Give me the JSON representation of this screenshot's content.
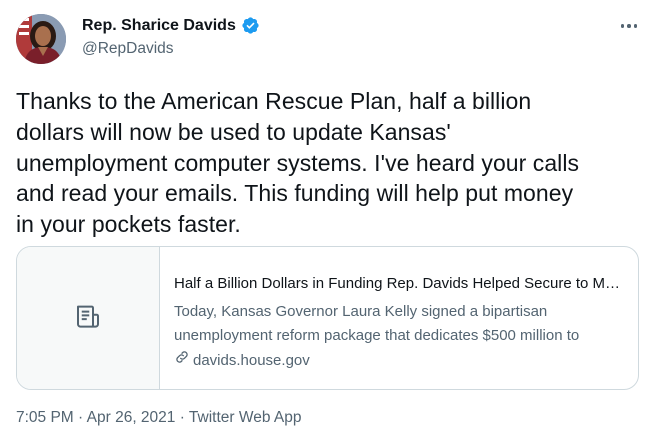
{
  "author": {
    "display_name": "Rep. Sharice Davids",
    "handle": "@RepDavids",
    "verified_icon": "verified-badge-icon"
  },
  "menu": {
    "icon": "more-icon"
  },
  "tweet": {
    "text": "Thanks to the American Rescue Plan, half a billion\ndollars will now be used to update Kansas'\nunemployment computer systems. I've heard your calls\nand read your emails. This funding will help put money\nin your pockets faster."
  },
  "card": {
    "media_icon": "document-icon",
    "title": "Half a Billion Dollars in Funding Rep. Davids Helped Secure to Modernize Kansas Unemployment System",
    "description_line1": "Today, Kansas Governor Laura Kelly signed a bipartisan",
    "description_line2": "unemployment reform package that dedicates $500 million to",
    "domain_icon": "link-icon",
    "domain": "davids.house.gov"
  },
  "meta": {
    "time": "7:05 PM",
    "separator1": " · ",
    "date": "Apr 26, 2021",
    "separator2": " · ",
    "source": "Twitter Web App"
  },
  "colors": {
    "text_primary": "#0f1419",
    "text_secondary": "#536471",
    "border": "#cfd9de",
    "verified_blue": "#1d9bf0"
  }
}
